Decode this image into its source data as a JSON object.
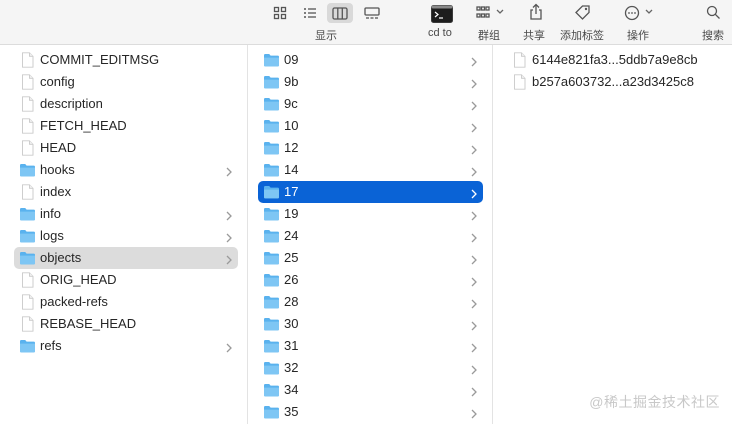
{
  "toolbar": {
    "view_label": "显示",
    "cdto_label": "cd to",
    "group_label": "群组",
    "share_label": "共享",
    "tag_label": "添加标签",
    "action_label": "操作",
    "search_label": "搜索"
  },
  "col1": [
    {
      "name": "COMMIT_EDITMSG",
      "kind": "file"
    },
    {
      "name": "config",
      "kind": "file"
    },
    {
      "name": "description",
      "kind": "file"
    },
    {
      "name": "FETCH_HEAD",
      "kind": "file"
    },
    {
      "name": "HEAD",
      "kind": "file"
    },
    {
      "name": "hooks",
      "kind": "folder"
    },
    {
      "name": "index",
      "kind": "file"
    },
    {
      "name": "info",
      "kind": "folder"
    },
    {
      "name": "logs",
      "kind": "folder"
    },
    {
      "name": "objects",
      "kind": "folder",
      "selected": "inactive"
    },
    {
      "name": "ORIG_HEAD",
      "kind": "file"
    },
    {
      "name": "packed-refs",
      "kind": "file"
    },
    {
      "name": "REBASE_HEAD",
      "kind": "file"
    },
    {
      "name": "refs",
      "kind": "folder"
    }
  ],
  "col2": [
    {
      "name": "09"
    },
    {
      "name": "9b"
    },
    {
      "name": "9c"
    },
    {
      "name": "10"
    },
    {
      "name": "12"
    },
    {
      "name": "14"
    },
    {
      "name": "17",
      "selected": "active"
    },
    {
      "name": "19"
    },
    {
      "name": "24"
    },
    {
      "name": "25"
    },
    {
      "name": "26"
    },
    {
      "name": "28"
    },
    {
      "name": "30"
    },
    {
      "name": "31"
    },
    {
      "name": "32"
    },
    {
      "name": "34"
    },
    {
      "name": "35"
    }
  ],
  "col3": [
    {
      "name": "6144e821fa3...5ddb7a9e8cb"
    },
    {
      "name": "b257a603732...a23d3425c8"
    }
  ],
  "watermark": "@稀土掘金技术社区",
  "colors": {
    "selection_active": "#0a63d6",
    "selection_inactive": "#dcdcdc",
    "folder": "#5ab2ee"
  }
}
